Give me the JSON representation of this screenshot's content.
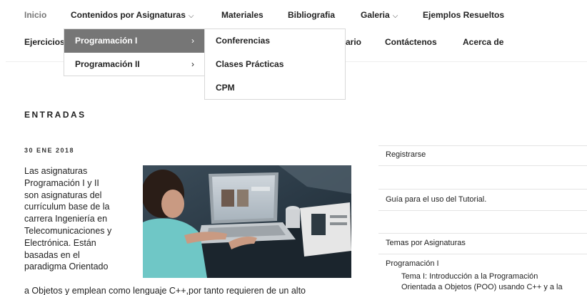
{
  "nav": {
    "row1": [
      {
        "label": "Inicio"
      },
      {
        "label": "Contenidos por Asignaturas"
      },
      {
        "label": "Materiales"
      },
      {
        "label": "Bibliografia"
      },
      {
        "label": "Galeria"
      },
      {
        "label": "Ejemplos Resueltos"
      }
    ],
    "row2": [
      {
        "label": "Ejercicios"
      },
      {
        "label": "ario"
      },
      {
        "label": "Contáctenos"
      },
      {
        "label": "Acerca de"
      }
    ],
    "chevron_glyph": "⌵"
  },
  "dropdown": {
    "items": [
      {
        "label": "Programación I",
        "arrow": "›"
      },
      {
        "label": "Programación II",
        "arrow": "›"
      }
    ],
    "submenu": [
      {
        "label": "Conferencias"
      },
      {
        "label": "Clases Prácticas"
      },
      {
        "label": "CPM"
      }
    ]
  },
  "main": {
    "section_title": "ENTRADAS",
    "post": {
      "date": "30 ENE 2018",
      "text_lines": [
        "Las asignaturas",
        "Programación I y II",
        "son asignaturas del",
        "currículum base de la",
        "carrera Ingeniería en",
        "Telecomunicaciones y",
        "Electrónica.  Están",
        "basadas en  el",
        "paradigma Orientado"
      ],
      "text_wide": "a Objetos y emplean como lenguaje C++,por tanto requieren de un alto"
    }
  },
  "sidebar": {
    "register": "Registrarse",
    "guide": "Guía para el uso del Tutorial.",
    "topics": "Temas por Asignaturas",
    "prog1": "Programación I",
    "tema_line1": "Tema I: Introducción a la Programación",
    "tema_line2": "Orientada a Objetos (POO) usando C++ y a la"
  },
  "colors": {
    "active_menu_bg": "#767676",
    "muted_nav": "#767676"
  }
}
